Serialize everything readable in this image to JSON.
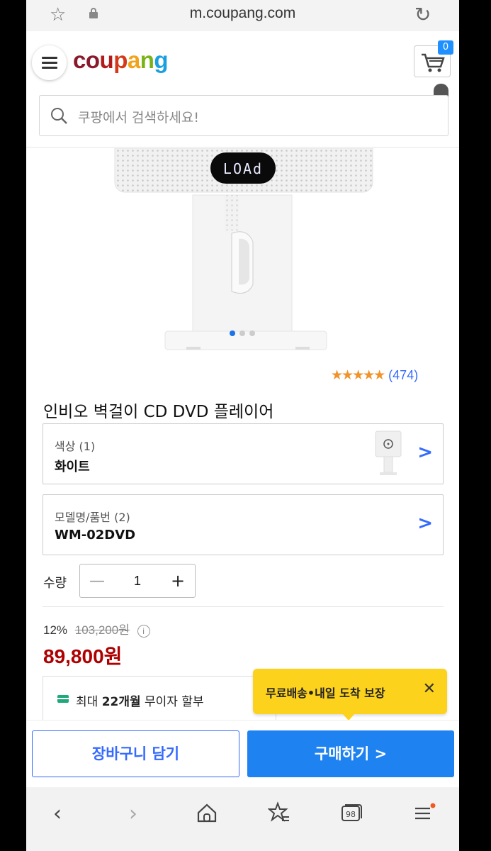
{
  "browser": {
    "url": "m.coupang.com"
  },
  "header": {
    "logo": [
      "c",
      "o",
      "u",
      "p",
      "a",
      "n",
      "g"
    ],
    "logo_colors": [
      "#8a1a2b",
      "#8a1a2b",
      "#b31b1b",
      "#d43a1a",
      "#f0a31b",
      "#7ab318",
      "#1aa0e0"
    ],
    "cart_count": "0",
    "search_placeholder": "쿠팡에서 검색하세요!"
  },
  "product": {
    "display_text": "LOAd",
    "image_page_index": 0,
    "image_page_count": 3,
    "rating_value": 4.5,
    "rating_count": "(474)",
    "title": "인비오 벽걸이 CD DVD 플레이어",
    "options": [
      {
        "label": "색상 (1)",
        "value": "화이트"
      },
      {
        "label": "모델명/품번 (2)",
        "value": "WM-02DVD"
      }
    ],
    "quantity_label": "수량",
    "quantity": "1",
    "discount_rate": "12%",
    "original_price": "103,200원",
    "price": "89,800원",
    "installment": {
      "prefix": "최대 ",
      "months": "22개월",
      "suffix": " 무이자 할부"
    },
    "tooltip": "무료배송•내일 도착 보장"
  },
  "actions": {
    "add_to_cart": "장바구니 담기",
    "buy_now": "구매하기 >"
  },
  "colors": {
    "accent_blue": "#346aff",
    "buy_button": "#1e82f0",
    "price_red": "#ae0000",
    "tooltip_yellow": "#fdd21c",
    "star_orange": "#f0932b"
  }
}
